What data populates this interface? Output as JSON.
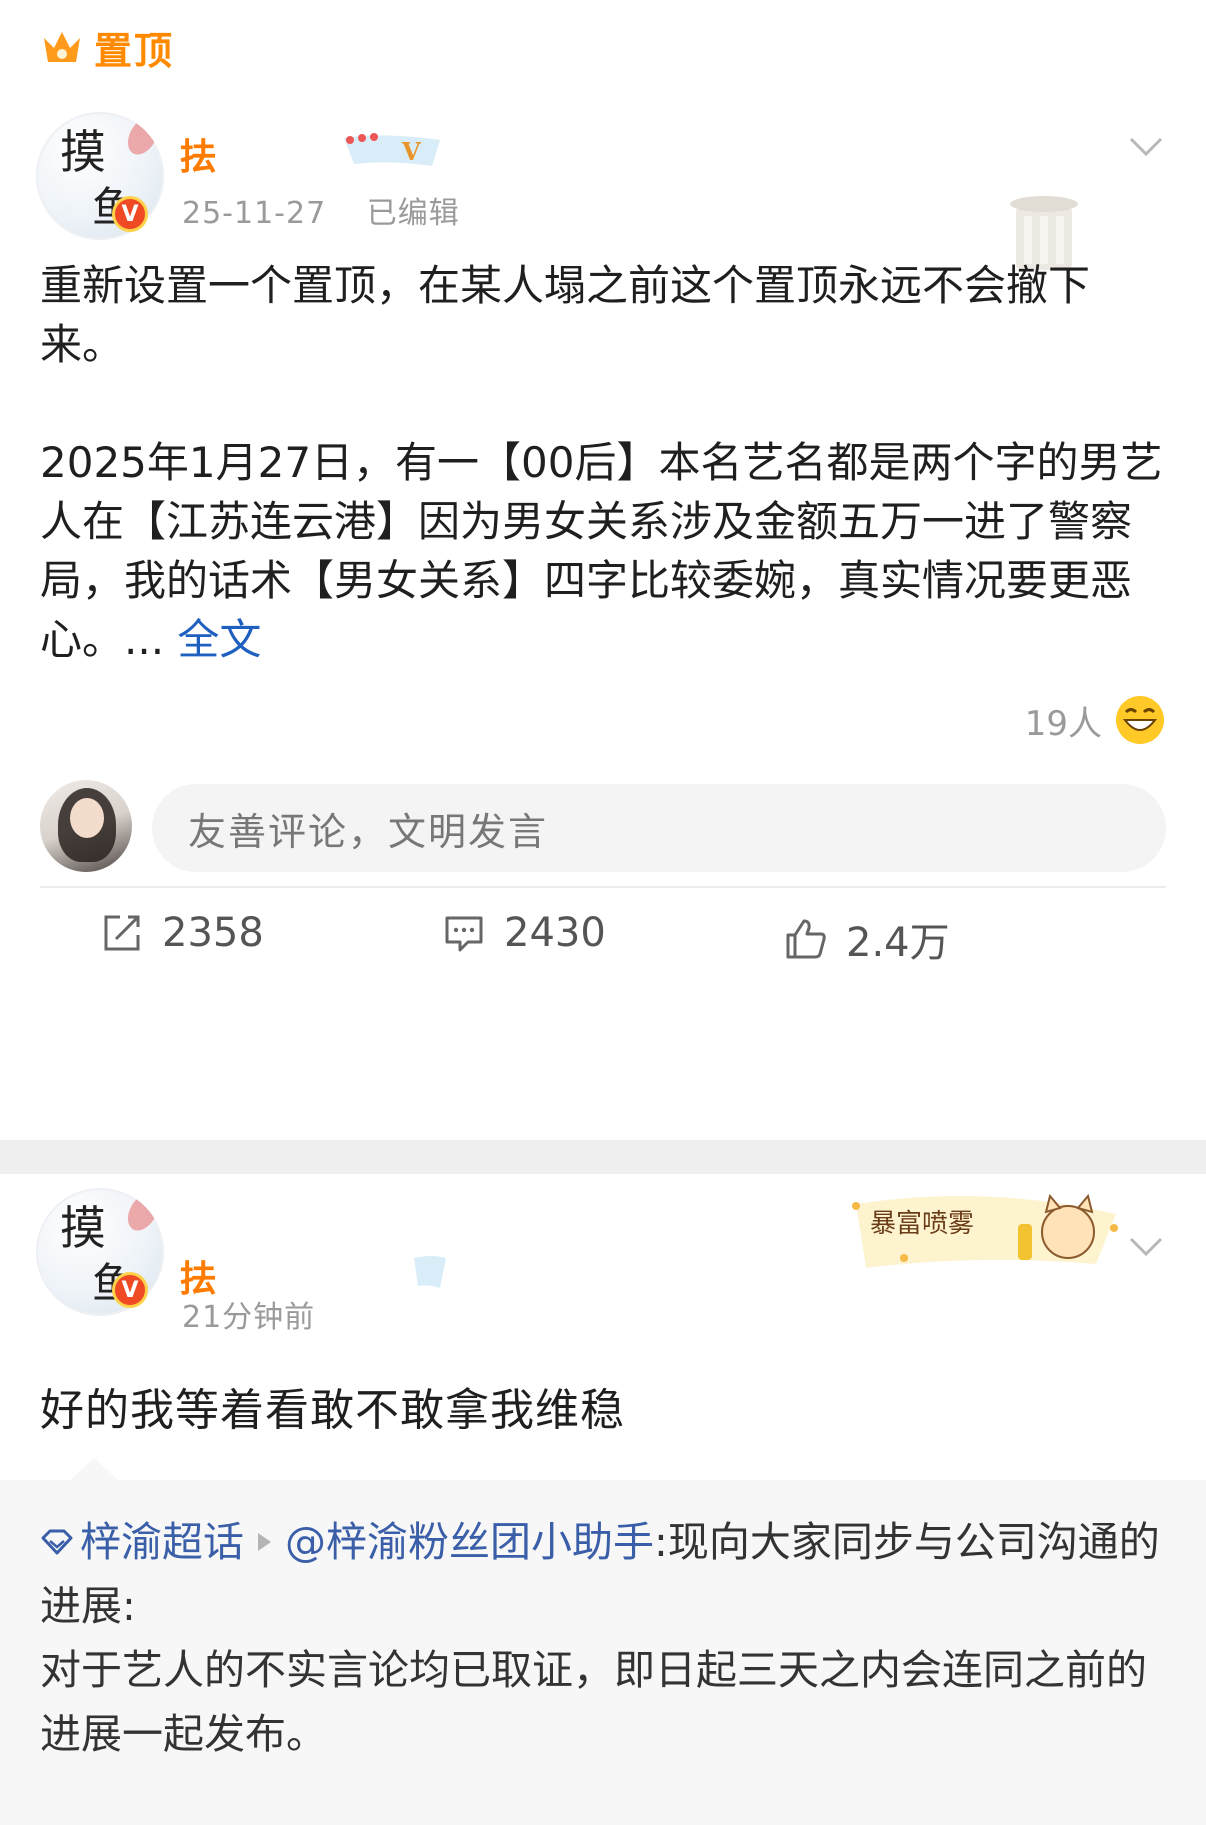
{
  "pinned": {
    "label": "置顶"
  },
  "post1": {
    "author_fragment": "抾",
    "date": "25-11-27",
    "edited": "已编辑",
    "paragraphs": [
      "重新设置一个置顶，在某人塌之前这个置顶永远不会撤下来。",
      "2025年1月27日，有一【00后】本名艺名都是两个字的男艺人在【江苏连云港】因为男女关系涉及金额五万一进了警察局，我的话术【男女关系】四字比较委婉，真实情况要更恶心。..."
    ],
    "full_text_link": "全文",
    "reaction_count": "19人",
    "comment_placeholder": "友善评论，文明发言",
    "reposts": "2358",
    "comments": "2430",
    "likes": "2.4万"
  },
  "post2": {
    "author_fragment": "抾",
    "time": "21分钟前",
    "decoration_text": "暴富喷雾",
    "text": "好的我等着看敢不敢拿我维稳",
    "quote": {
      "topic": "梓渝超话",
      "mention": "@梓渝粉丝团小助手",
      "line1": ":现向大家同步与公司沟通的进展:",
      "line2": "对于艺人的不实言论均已取证，即日起三天之内会连同之前的进展一起发布。"
    }
  },
  "colors": {
    "accent_orange": "#ff8a00",
    "link_blue": "#1e5fbf",
    "verified_red": "#f04a24"
  },
  "icons": [
    "crown-icon",
    "vip-badge-icon",
    "chevron-down-icon",
    "grin-emoji-icon",
    "repost-icon",
    "comment-icon",
    "like-icon",
    "super-topic-gem-icon"
  ]
}
